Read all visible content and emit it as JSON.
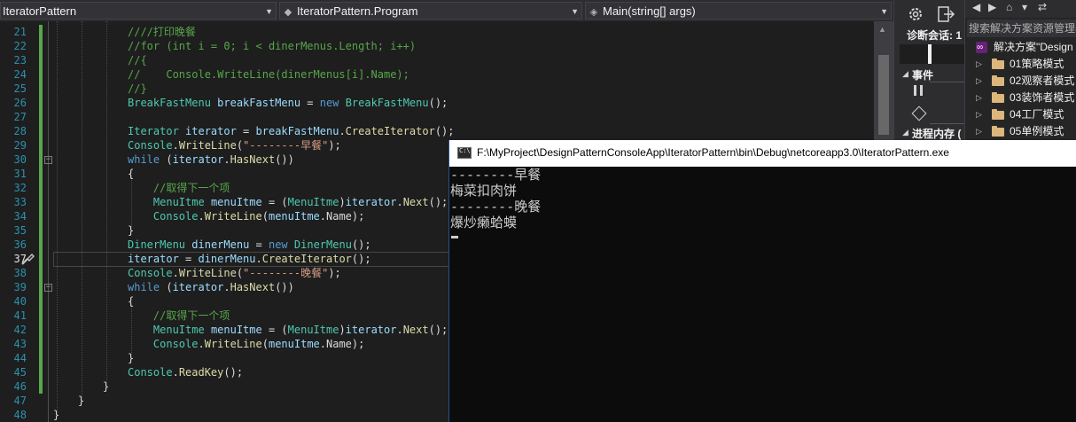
{
  "navbar": {
    "project_dropdown": "IteratorPattern",
    "class_dropdown": "IteratorPattern.Program",
    "method_dropdown": "Main(string[] args)"
  },
  "editor": {
    "current_line": 37,
    "lines": [
      {
        "n": "21",
        "segs": [
          {
            "c": "cm",
            "t": "////打印晚餐"
          }
        ]
      },
      {
        "n": "22",
        "segs": [
          {
            "c": "cm",
            "t": "//for (int i = 0; i < dinerMenus.Length; i++)"
          }
        ]
      },
      {
        "n": "23",
        "segs": [
          {
            "c": "cm",
            "t": "//{"
          }
        ]
      },
      {
        "n": "24",
        "segs": [
          {
            "c": "cm",
            "t": "//    Console.WriteLine(dinerMenus[i].Name);"
          }
        ]
      },
      {
        "n": "25",
        "segs": [
          {
            "c": "cm",
            "t": "//}"
          }
        ]
      },
      {
        "n": "26",
        "segs": [
          {
            "c": "ty",
            "t": "BreakFastMenu"
          },
          {
            "c": "",
            "t": " "
          },
          {
            "c": "vr",
            "t": "breakFastMenu"
          },
          {
            "c": "",
            "t": " = "
          },
          {
            "c": "kw",
            "t": "new"
          },
          {
            "c": "",
            "t": " "
          },
          {
            "c": "ty",
            "t": "BreakFastMenu"
          },
          {
            "c": "",
            "t": "();"
          }
        ]
      },
      {
        "n": "27",
        "segs": []
      },
      {
        "n": "28",
        "segs": [
          {
            "c": "ty",
            "t": "Iterator"
          },
          {
            "c": "",
            "t": " "
          },
          {
            "c": "vr",
            "t": "iterator"
          },
          {
            "c": "",
            "t": " = "
          },
          {
            "c": "vr",
            "t": "breakFastMenu"
          },
          {
            "c": "",
            "t": "."
          },
          {
            "c": "mt",
            "t": "CreateIterator"
          },
          {
            "c": "",
            "t": "();"
          }
        ]
      },
      {
        "n": "29",
        "segs": [
          {
            "c": "ty",
            "t": "Console"
          },
          {
            "c": "",
            "t": "."
          },
          {
            "c": "mt",
            "t": "WriteLine"
          },
          {
            "c": "",
            "t": "("
          },
          {
            "c": "st",
            "t": "\"--------早餐\""
          },
          {
            "c": "",
            "t": ");"
          }
        ]
      },
      {
        "n": "30",
        "segs": [
          {
            "c": "kw",
            "t": "while"
          },
          {
            "c": "",
            "t": " ("
          },
          {
            "c": "vr",
            "t": "iterator"
          },
          {
            "c": "",
            "t": "."
          },
          {
            "c": "mt",
            "t": "HasNext"
          },
          {
            "c": "",
            "t": "())"
          }
        ]
      },
      {
        "n": "31",
        "segs": [
          {
            "c": "",
            "t": "{"
          }
        ]
      },
      {
        "n": "32",
        "segs": [
          {
            "c": "",
            "t": "    "
          },
          {
            "c": "cm",
            "t": "//取得下一个项"
          }
        ]
      },
      {
        "n": "33",
        "segs": [
          {
            "c": "",
            "t": "    "
          },
          {
            "c": "ty",
            "t": "MenuItme"
          },
          {
            "c": "",
            "t": " "
          },
          {
            "c": "vr",
            "t": "menuItme"
          },
          {
            "c": "",
            "t": " = ("
          },
          {
            "c": "ty",
            "t": "MenuItme"
          },
          {
            "c": "",
            "t": ")"
          },
          {
            "c": "vr",
            "t": "iterator"
          },
          {
            "c": "",
            "t": "."
          },
          {
            "c": "mt",
            "t": "Next"
          },
          {
            "c": "",
            "t": "();"
          }
        ]
      },
      {
        "n": "34",
        "segs": [
          {
            "c": "",
            "t": "    "
          },
          {
            "c": "ty",
            "t": "Console"
          },
          {
            "c": "",
            "t": "."
          },
          {
            "c": "mt",
            "t": "WriteLine"
          },
          {
            "c": "",
            "t": "("
          },
          {
            "c": "vr",
            "t": "menuItme"
          },
          {
            "c": "",
            "t": ".Name);"
          }
        ]
      },
      {
        "n": "35",
        "segs": [
          {
            "c": "",
            "t": "}"
          }
        ]
      },
      {
        "n": "36",
        "segs": [
          {
            "c": "ty",
            "t": "DinerMenu"
          },
          {
            "c": "",
            "t": " "
          },
          {
            "c": "vr",
            "t": "dinerMenu"
          },
          {
            "c": "",
            "t": " = "
          },
          {
            "c": "kw",
            "t": "new"
          },
          {
            "c": "",
            "t": " "
          },
          {
            "c": "ty",
            "t": "DinerMenu"
          },
          {
            "c": "",
            "t": "();"
          }
        ]
      },
      {
        "n": "37",
        "segs": [
          {
            "c": "vr",
            "t": "iterator"
          },
          {
            "c": "",
            "t": " = "
          },
          {
            "c": "vr",
            "t": "dinerMenu"
          },
          {
            "c": "",
            "t": "."
          },
          {
            "c": "mt",
            "t": "CreateIterator"
          },
          {
            "c": "",
            "t": "();"
          }
        ]
      },
      {
        "n": "38",
        "segs": [
          {
            "c": "ty",
            "t": "Console"
          },
          {
            "c": "",
            "t": "."
          },
          {
            "c": "mt",
            "t": "WriteLine"
          },
          {
            "c": "",
            "t": "("
          },
          {
            "c": "st",
            "t": "\"--------晚餐\""
          },
          {
            "c": "",
            "t": ");"
          }
        ]
      },
      {
        "n": "39",
        "segs": [
          {
            "c": "kw",
            "t": "while"
          },
          {
            "c": "",
            "t": " ("
          },
          {
            "c": "vr",
            "t": "iterator"
          },
          {
            "c": "",
            "t": "."
          },
          {
            "c": "mt",
            "t": "HasNext"
          },
          {
            "c": "",
            "t": "())"
          }
        ]
      },
      {
        "n": "40",
        "segs": [
          {
            "c": "",
            "t": "{"
          }
        ]
      },
      {
        "n": "41",
        "segs": [
          {
            "c": "",
            "t": "    "
          },
          {
            "c": "cm",
            "t": "//取得下一个项"
          }
        ]
      },
      {
        "n": "42",
        "segs": [
          {
            "c": "",
            "t": "    "
          },
          {
            "c": "ty",
            "t": "MenuItme"
          },
          {
            "c": "",
            "t": " "
          },
          {
            "c": "vr",
            "t": "menuItme"
          },
          {
            "c": "",
            "t": " = ("
          },
          {
            "c": "ty",
            "t": "MenuItme"
          },
          {
            "c": "",
            "t": ")"
          },
          {
            "c": "vr",
            "t": "iterator"
          },
          {
            "c": "",
            "t": "."
          },
          {
            "c": "mt",
            "t": "Next"
          },
          {
            "c": "",
            "t": "();"
          }
        ]
      },
      {
        "n": "43",
        "segs": [
          {
            "c": "",
            "t": "    "
          },
          {
            "c": "ty",
            "t": "Console"
          },
          {
            "c": "",
            "t": "."
          },
          {
            "c": "mt",
            "t": "WriteLine"
          },
          {
            "c": "",
            "t": "("
          },
          {
            "c": "vr",
            "t": "menuItme"
          },
          {
            "c": "",
            "t": ".Name);"
          }
        ]
      },
      {
        "n": "44",
        "segs": [
          {
            "c": "",
            "t": "}"
          }
        ]
      },
      {
        "n": "45",
        "segs": [
          {
            "c": "ty",
            "t": "Console"
          },
          {
            "c": "",
            "t": "."
          },
          {
            "c": "mt",
            "t": "ReadKey"
          },
          {
            "c": "",
            "t": "();"
          }
        ]
      },
      {
        "n": "46",
        "segs": [
          {
            "c": "",
            "t": "}"
          }
        ]
      },
      {
        "n": "47",
        "segs": [
          {
            "c": "",
            "t": "}"
          }
        ]
      },
      {
        "n": "48",
        "segs": [
          {
            "c": "",
            "t": "}"
          }
        ]
      }
    ]
  },
  "diagnostics": {
    "title": "诊断会话: 1",
    "events_label": "事件",
    "memory_label": "进程内存 ("
  },
  "solution_explorer": {
    "search_placeholder": "搜索解决方案资源管理器",
    "solution_label": "解决方案\"Design",
    "folders": [
      "01策略模式",
      "02观察者模式",
      "03装饰者模式",
      "04工厂模式",
      "05单例模式"
    ]
  },
  "console": {
    "title": "F:\\MyProject\\DesignPatternConsoleApp\\IteratorPattern\\bin\\Debug\\netcoreapp3.0\\IteratorPattern.exe",
    "output": [
      "--------早餐",
      "梅菜扣肉饼",
      "--------晚餐",
      "爆炒癞蛤蟆"
    ]
  },
  "colors": {
    "accent": "#007acc",
    "comment": "#57a64a",
    "keyword": "#569cd6",
    "type": "#4ec9b0",
    "string": "#d69d85"
  }
}
